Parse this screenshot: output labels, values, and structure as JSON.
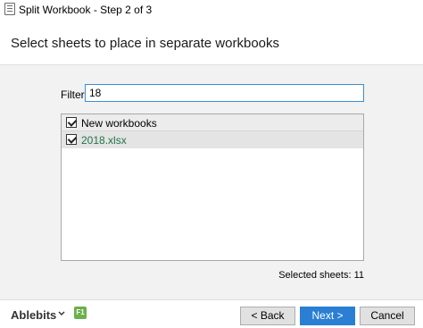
{
  "window": {
    "title": "Split Workbook - Step 2 of 3",
    "icon": "workbook-icon"
  },
  "header": {
    "title": "Select sheets to place in separate workbooks"
  },
  "filter": {
    "label": "Filter:",
    "value": "18"
  },
  "tree": {
    "root": {
      "label": "New workbooks",
      "checked": true
    },
    "items": [
      {
        "label": "2018.xlsx",
        "checked": true
      }
    ]
  },
  "status": {
    "selected_sheets": "Selected sheets: 11"
  },
  "footer": {
    "brand": "Ablebits",
    "help_badge": "F1",
    "back_label": "< Back",
    "next_label": "Next >",
    "cancel_label": "Cancel"
  },
  "colors": {
    "accent": "#2a7fd4",
    "file_text": "#217346",
    "help_badge": "#6ab04c"
  }
}
